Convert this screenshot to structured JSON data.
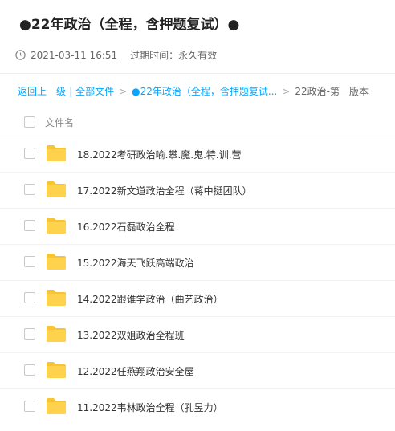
{
  "header": {
    "title": "●22年政治（全程，含押题复试）●",
    "date": "2021-03-11 16:51",
    "expire_label": "过期时间：永久有效"
  },
  "breadcrumb": {
    "back": "返回上一级",
    "separator": "|",
    "all_files": "全部文件",
    "folder": "●22年政治（全程，含押题复试...",
    "current": "22政治-第一版本",
    "arrow": ">"
  },
  "list": {
    "header_label": "文件名",
    "items": [
      {
        "name": "18.2022考研政治喻.攀.魔.鬼.特.训.营"
      },
      {
        "name": "17.2022新文道政治全程（蒋中挺团队）"
      },
      {
        "name": "16.2022石磊政治全程"
      },
      {
        "name": "15.2022海天飞跃高端政治"
      },
      {
        "name": "14.2022跟谁学政治（曲艺政治）"
      },
      {
        "name": "13.2022双姐政治全程班"
      },
      {
        "name": "12.2022任燕翔政治安全屋"
      },
      {
        "name": "11.2022韦林政治全程（孔昱力）"
      }
    ]
  },
  "colors": {
    "link": "#06a7ff",
    "folder": "#ffd24d",
    "folder_tab": "#f7c435"
  }
}
